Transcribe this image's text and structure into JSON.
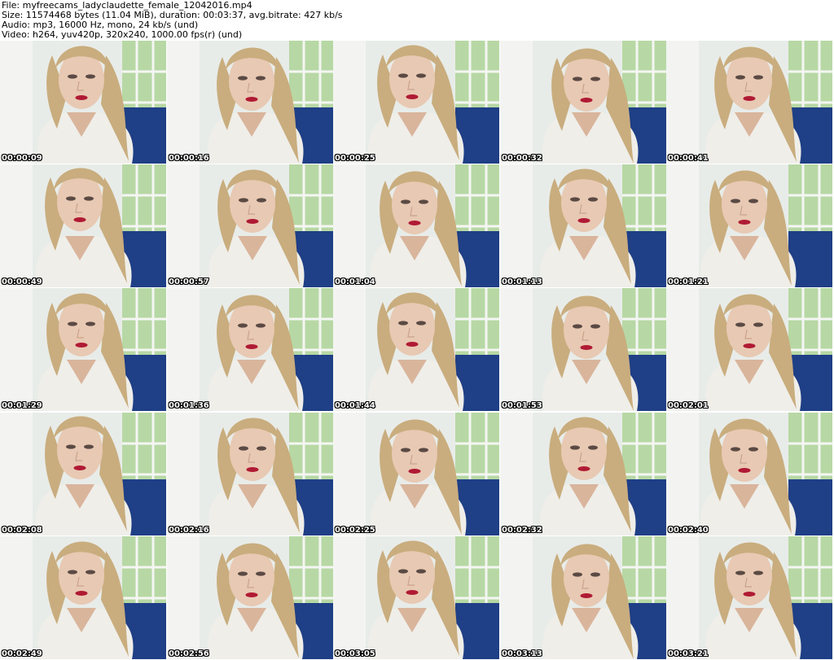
{
  "header": {
    "file_line": "File: myfreecams_ladyclaudette_female_12042016.mp4",
    "size_line": "Size: 11574468 bytes (11.04 MiB), duration: 00:03:37, avg.bitrate: 427 kb/s",
    "audio_line": "Audio: mp3, 16000 Hz, mono, 24 kb/s (und)",
    "video_line": "Video: h264, yuv420p, 320x240, 1000.00 fps(r) (und)"
  },
  "thumbnails": [
    {
      "time": "00:00:09"
    },
    {
      "time": "00:00:16"
    },
    {
      "time": "00:00:25"
    },
    {
      "time": "00:00:32"
    },
    {
      "time": "00:00:41"
    },
    {
      "time": "00:00:49"
    },
    {
      "time": "00:00:57"
    },
    {
      "time": "00:01:04"
    },
    {
      "time": "00:01:13"
    },
    {
      "time": "00:01:21"
    },
    {
      "time": "00:01:29"
    },
    {
      "time": "00:01:36"
    },
    {
      "time": "00:01:44"
    },
    {
      "time": "00:01:53"
    },
    {
      "time": "00:02:01"
    },
    {
      "time": "00:02:08"
    },
    {
      "time": "00:02:16"
    },
    {
      "time": "00:02:25"
    },
    {
      "time": "00:02:32"
    },
    {
      "time": "00:02:40"
    },
    {
      "time": "00:02:49"
    },
    {
      "time": "00:02:56"
    },
    {
      "time": "00:03:05"
    },
    {
      "time": "00:03:13"
    },
    {
      "time": "00:03:21"
    }
  ],
  "colors": {
    "background": "#ffffff",
    "wall": "#e8ece9",
    "window_green": "#b7d8a4",
    "sofa_blue": "#1f3f86",
    "sweater": "#efeee9",
    "hair": "#c9ad7e",
    "skin": "#e8c9b3",
    "lips": "#b01a34"
  }
}
